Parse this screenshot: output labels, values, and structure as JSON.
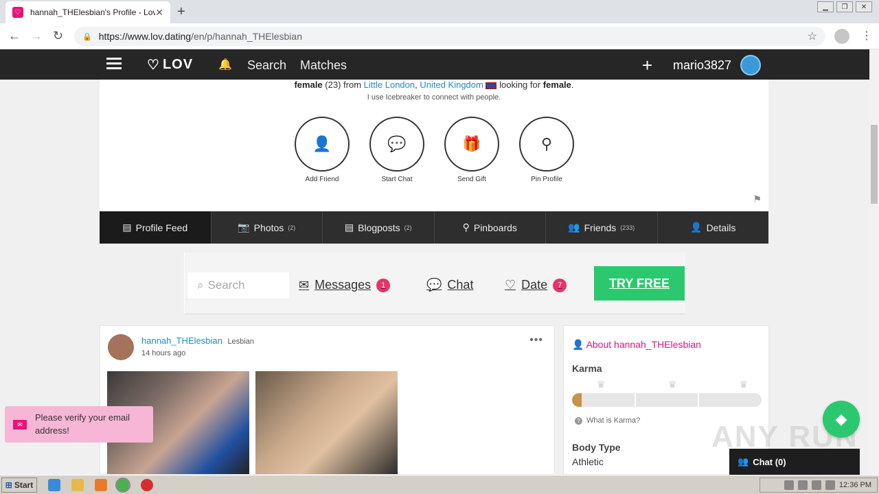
{
  "browser": {
    "tab_title": "hannah_THElesbian's Profile - Lov",
    "url_host": "https://www.lov.dating",
    "url_path": "/en/p/hannah_THElesbian"
  },
  "site": {
    "logo": "LOV",
    "nav_search": "Search",
    "nav_matches": "Matches",
    "username": "mario3827"
  },
  "profile": {
    "gender": "female",
    "age": "(23) from",
    "city": "Little London",
    "country": "United Kingdom",
    "looking": "looking for",
    "looking_for": "female",
    "tagline": "I use Icebreaker to connect with people.",
    "actions": [
      {
        "label": "Add Friend",
        "icon": "add-friend-icon"
      },
      {
        "label": "Start Chat",
        "icon": "chat-bubble-icon"
      },
      {
        "label": "Send Gift",
        "icon": "gift-icon"
      },
      {
        "label": "Pin Profile",
        "icon": "pin-icon"
      }
    ]
  },
  "tabs": [
    {
      "label": "Profile Feed",
      "count": "",
      "active": true,
      "icon": "feed-icon"
    },
    {
      "label": "Photos",
      "count": "(2)",
      "icon": "camera-icon"
    },
    {
      "label": "Blogposts",
      "count": "(2)",
      "icon": "blog-icon"
    },
    {
      "label": "Pinboards",
      "count": "",
      "icon": "pin-icon"
    },
    {
      "label": "Friends",
      "count": "(233)",
      "icon": "friends-icon"
    },
    {
      "label": "Details",
      "count": "",
      "icon": "user-icon"
    }
  ],
  "promo": {
    "search_placeholder": "Search",
    "messages": "Messages",
    "messages_count": "1",
    "chat": "Chat",
    "date": "Date",
    "date_count": "7",
    "cta": "TRY FREE"
  },
  "post": {
    "author": "hannah_THElesbian",
    "tag": "Lesbian",
    "time": "14 hours ago"
  },
  "about": {
    "title": "About hannah_THElesbian",
    "karma_label": "Karma",
    "karma_fraction": 0.05,
    "karma_help": "What is Karma?",
    "body_type_label": "Body Type",
    "body_type_value": "Athletic"
  },
  "notification": {
    "text": "Please verify your email address!"
  },
  "chat": {
    "label": "Chat (0)"
  },
  "watermark": "ANY RUN",
  "taskbar": {
    "start": "Start",
    "clock": "12:36 PM"
  }
}
